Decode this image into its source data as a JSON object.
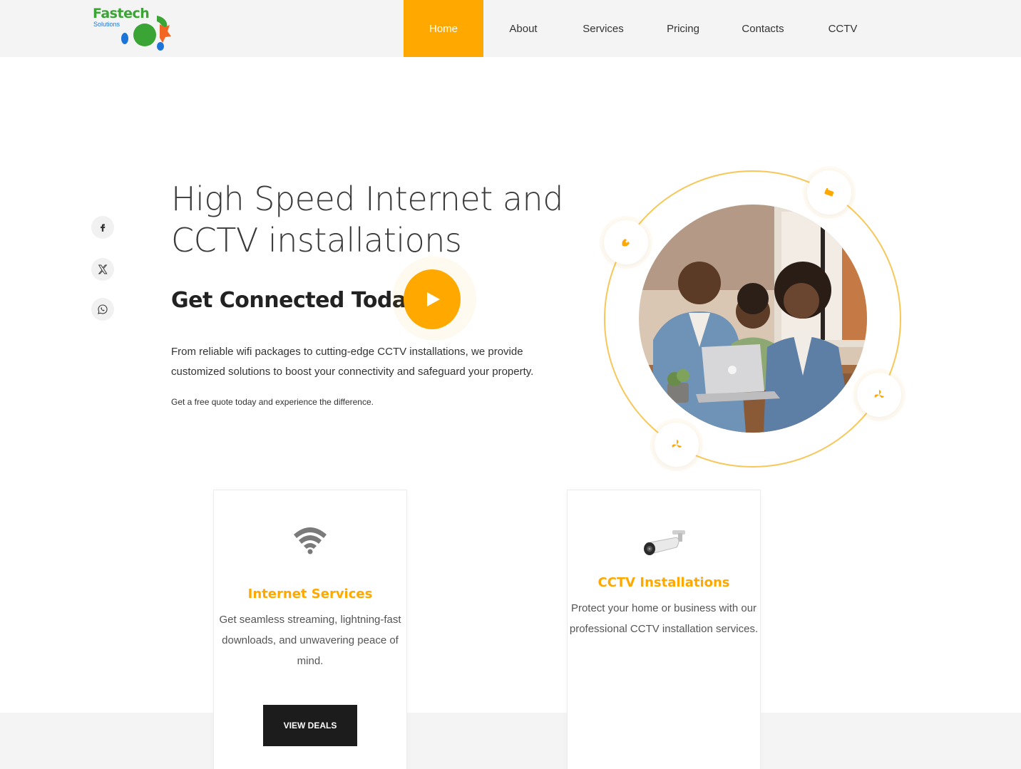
{
  "brand": {
    "name": "Fastech",
    "tagline": "Solutions",
    "colors": {
      "accent": "#ffa800",
      "green": "#3aa435",
      "blue": "#1d74d8",
      "orange": "#f26522"
    }
  },
  "nav": {
    "items": [
      {
        "label": "Home",
        "active": true
      },
      {
        "label": "About"
      },
      {
        "label": "Services"
      },
      {
        "label": "Pricing"
      },
      {
        "label": "Contacts"
      },
      {
        "label": "CCTV"
      }
    ]
  },
  "social": [
    {
      "icon": "facebook-icon"
    },
    {
      "icon": "x-twitter-icon"
    },
    {
      "icon": "whatsapp-icon"
    }
  ],
  "hero": {
    "title_line1": "High Speed Internet and",
    "title_line2": "CCTV installations",
    "subtitle": "Get Connected Today",
    "play_icon": "play-icon",
    "paragraph_line1": "From reliable wifi packages to cutting-edge CCTV installations, we provide",
    "paragraph_line2": "customized solutions to boost your connectivity and safeguard your property.",
    "small_text": "Get a free quote today and experience the difference."
  },
  "cards": [
    {
      "icon": "wifi-icon",
      "title": "Internet Services",
      "text": "Get seamless streaming, lightning-fast downloads, and unwavering peace of mind.",
      "button": "VIEW DEALS"
    },
    {
      "icon": "cctv-camera-icon",
      "title": "CCTV Installations",
      "text": "Protect your home or business with our professional CCTV installation services."
    }
  ]
}
